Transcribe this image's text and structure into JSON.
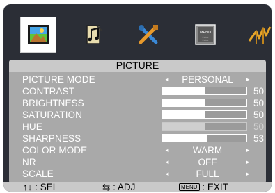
{
  "menu": {
    "title": "PICTURE",
    "rows": [
      {
        "label": "PICTURE MODE",
        "value": "PERSONAL"
      },
      {
        "label": "CONTRAST",
        "level": 0.5,
        "number": "50"
      },
      {
        "label": "BRIGHTNESS",
        "level": 0.5,
        "number": "50"
      },
      {
        "label": "SATURATION",
        "level": 0.5,
        "number": "50"
      },
      {
        "label": "HUE",
        "level": 0.5,
        "number": "50"
      },
      {
        "label": "SHARPNESS",
        "level": 0.53,
        "number": "53"
      },
      {
        "label": "COLOR MODE",
        "value": "WARM"
      },
      {
        "label": "NR",
        "value": "OFF"
      },
      {
        "label": "SCALE",
        "value": "FULL"
      }
    ]
  },
  "tabs": [
    {
      "icon": "picture-icon"
    },
    {
      "icon": "audio-icon"
    },
    {
      "icon": "tools-icon"
    },
    {
      "icon": "menu-icon",
      "text": "MENU"
    },
    {
      "icon": "antenna-icon"
    }
  ],
  "footer": {
    "sel_glyph": "↑↓",
    "sel_label": ": SEL",
    "adj_glyph": "⇆",
    "adj_label": ": ADJ",
    "menu_key": "MENU",
    "exit_label": ": EXIT"
  }
}
